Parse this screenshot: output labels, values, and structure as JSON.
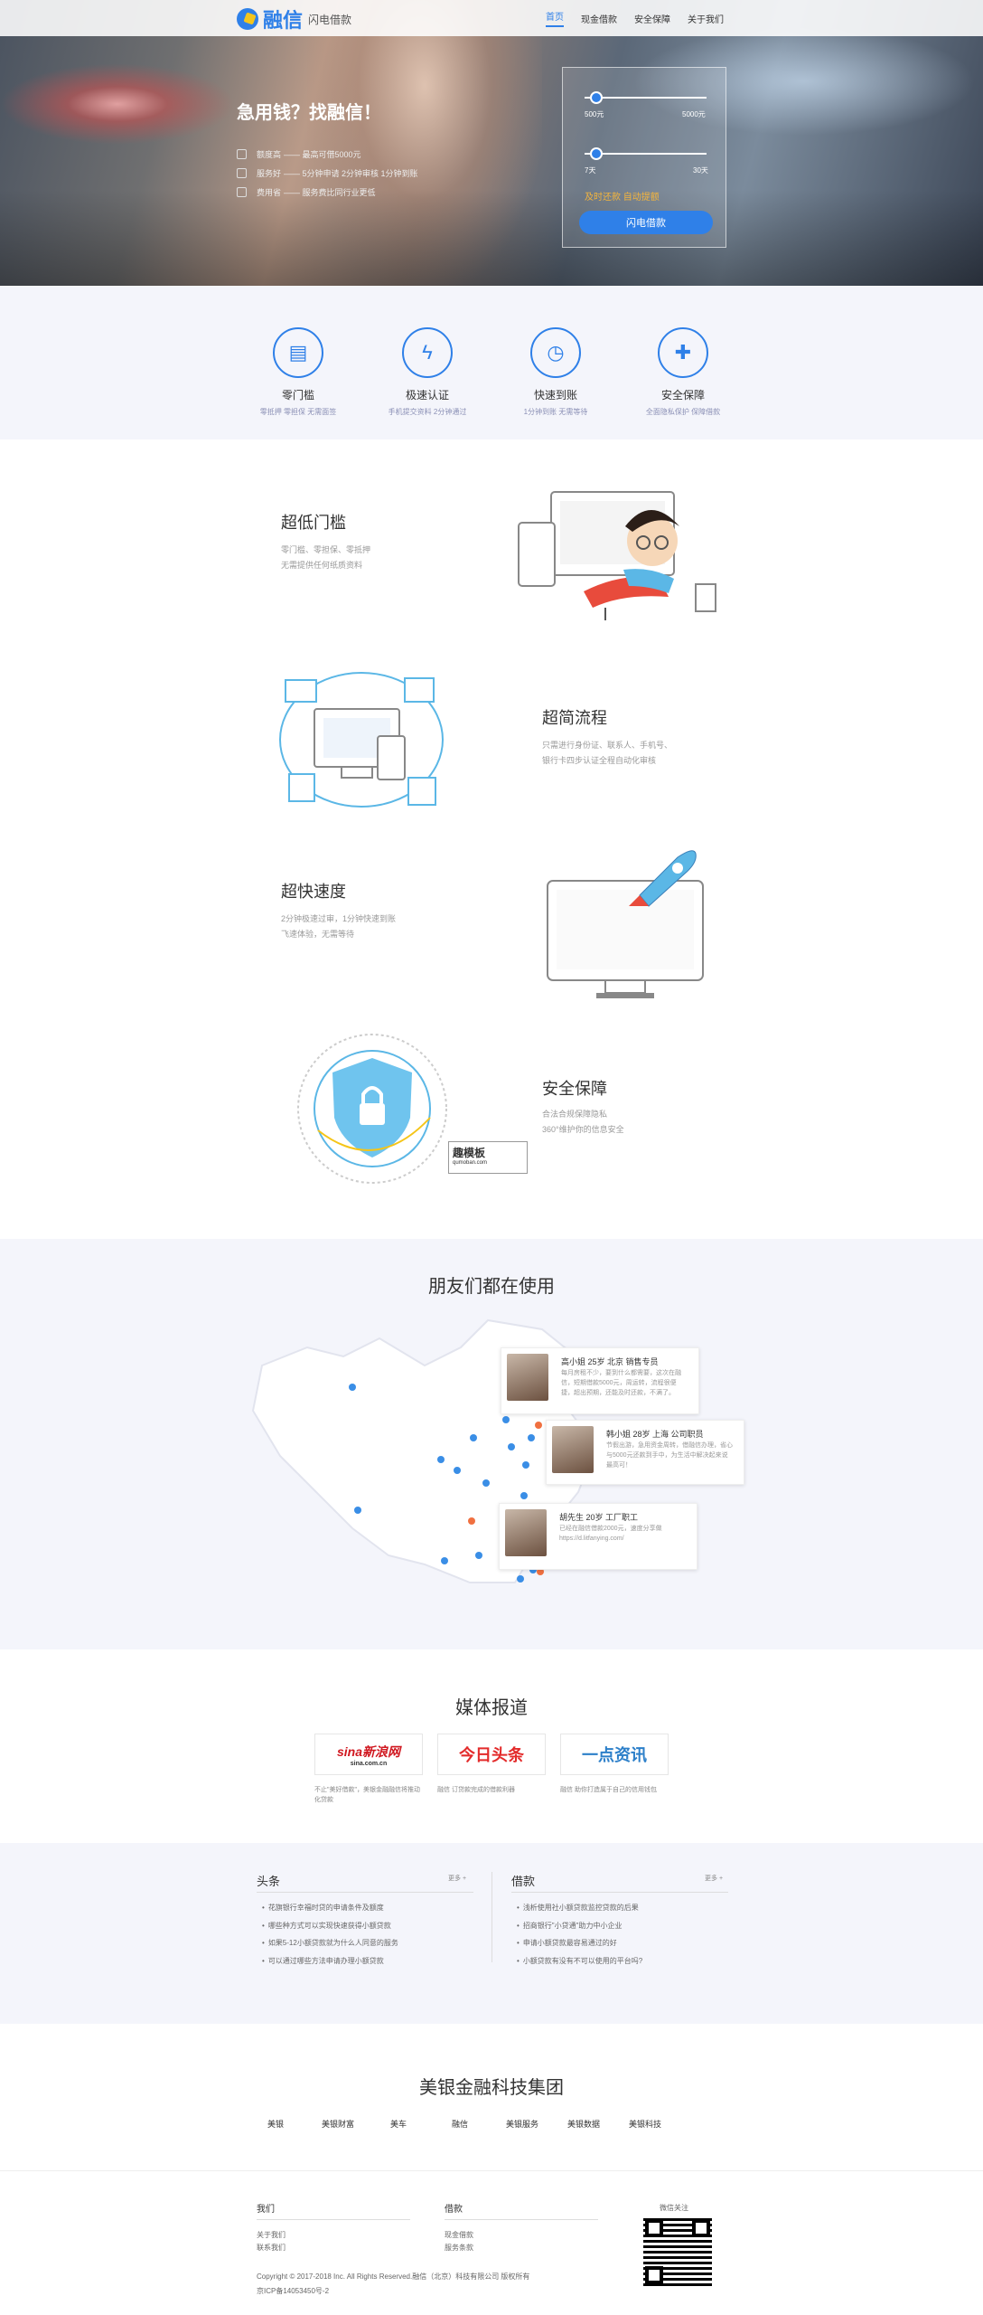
{
  "header": {
    "brand": "融信",
    "brand_sub": "闪电借款",
    "nav": [
      "首页",
      "现金借款",
      "安全保障",
      "关于我们"
    ]
  },
  "hero": {
    "title": "急用钱？找融信！",
    "items": [
      {
        "label": "额度高",
        "text": "—— 最高可借5000元"
      },
      {
        "label": "服务好",
        "text": "—— 5分钟申请 2分钟审核 1分钟到账"
      },
      {
        "label": "费用省",
        "text": "—— 服务费比同行业更低"
      }
    ],
    "amount_min": "500元",
    "amount_max": "5000元",
    "days_min": "7天",
    "days_max": "30天",
    "note": "及时还款 自动提额",
    "button": "闪电借款",
    "amount_level": 0.05,
    "days_level": 0.05
  },
  "features": [
    {
      "icon": "document-icon",
      "title": "零门槛",
      "desc": "零抵押 零担保 无需面签"
    },
    {
      "icon": "lightning-icon",
      "title": "极速认证",
      "desc": "手机提交资料 2分钟通过"
    },
    {
      "icon": "stopwatch-icon",
      "title": "快速到账",
      "desc": "1分钟到账 无需等待"
    },
    {
      "icon": "shield-plus-icon",
      "title": "安全保障",
      "desc": "全面隐私保护 保障借款"
    }
  ],
  "blocks": [
    {
      "title": "超低门槛",
      "desc": [
        "零门槛、零担保、零抵押",
        "无需提供任何纸质资料"
      ]
    },
    {
      "title": "超简流程",
      "desc": [
        "只需进行身份证、联系人、手机号、",
        "银行卡四步认证全程自动化审核"
      ]
    },
    {
      "title": "超快速度",
      "desc": [
        "2分钟极速过审，1分钟快速到账",
        "飞速体验，无需等待"
      ]
    },
    {
      "title": "安全保障",
      "desc": [
        "合法合规保障隐私",
        "360°维护你的信息安全"
      ]
    }
  ],
  "watermark": {
    "main": "趣模板",
    "url": "qumoban.com"
  },
  "friends": {
    "title": "朋友们都在使用",
    "cards": [
      {
        "name": "高小姐 25岁 北京 销售专员",
        "quote": "每月房租不少，要到什么都需要，这次在融信，短期借款5000元，周运转，流程很便捷，超出预期，还能及时还款，不满了。"
      },
      {
        "name": "韩小姐 28岁 上海 公司职员",
        "quote": "节假出游，急用资金周转，借融信办理，省心与5000元还款到手中，为生活中解决起来说最高可！"
      },
      {
        "name": "胡先生 20岁 工厂职工",
        "quote": "已经在融信借款2000元，速度分享做 https://d.litfanying.com/"
      }
    ]
  },
  "media": {
    "title": "媒体报道",
    "items": [
      {
        "logo": "sina新浪网",
        "logo_sub": "sina.com.cn",
        "caption": "不止\"美好借款\"，美银金融融信将推动化贷款"
      },
      {
        "logo": "今日头条",
        "logo_sub": "",
        "caption": "融信 订贷款完成的借款利器"
      },
      {
        "logo": "一点资讯",
        "logo_sub": "",
        "caption": "融信 助你打造属于自己的信用钱包"
      }
    ]
  },
  "news": {
    "left_title": "头条",
    "right_title": "借款",
    "more": "更多 +",
    "left": [
      "花旗银行幸福时贷的申请条件及额度",
      "哪些种方式可以实现快速获得小额贷款",
      "如果5-12小额贷款就为什么人同意的服务",
      "可以通过哪些方法申请办理小额贷款"
    ],
    "right": [
      "浅析使用社小额贷款监控贷款的后果",
      "招商银行\"小贷通\"助力中小企业",
      "申请小额贷款最容易通过的好",
      "小额贷款有没有不可以使用的平台吗?"
    ]
  },
  "group": {
    "title": "美银金融科技集团",
    "links": [
      "美银",
      "美银财富",
      "美车",
      "融信",
      "美银服务",
      "美银数据",
      "美银科技"
    ]
  },
  "footer": {
    "col1_title": "我们",
    "col1": [
      "关于我们",
      "联系我们"
    ],
    "col2_title": "借款",
    "col2": [
      "现金借款",
      "服务条款"
    ],
    "qr_label": "微信关注",
    "copyright": "Copyright © 2017-2018 Inc. All Rights Reserved.融信（北京）科技有限公司 版权所有",
    "icp": "京ICP备14053450号-2"
  }
}
